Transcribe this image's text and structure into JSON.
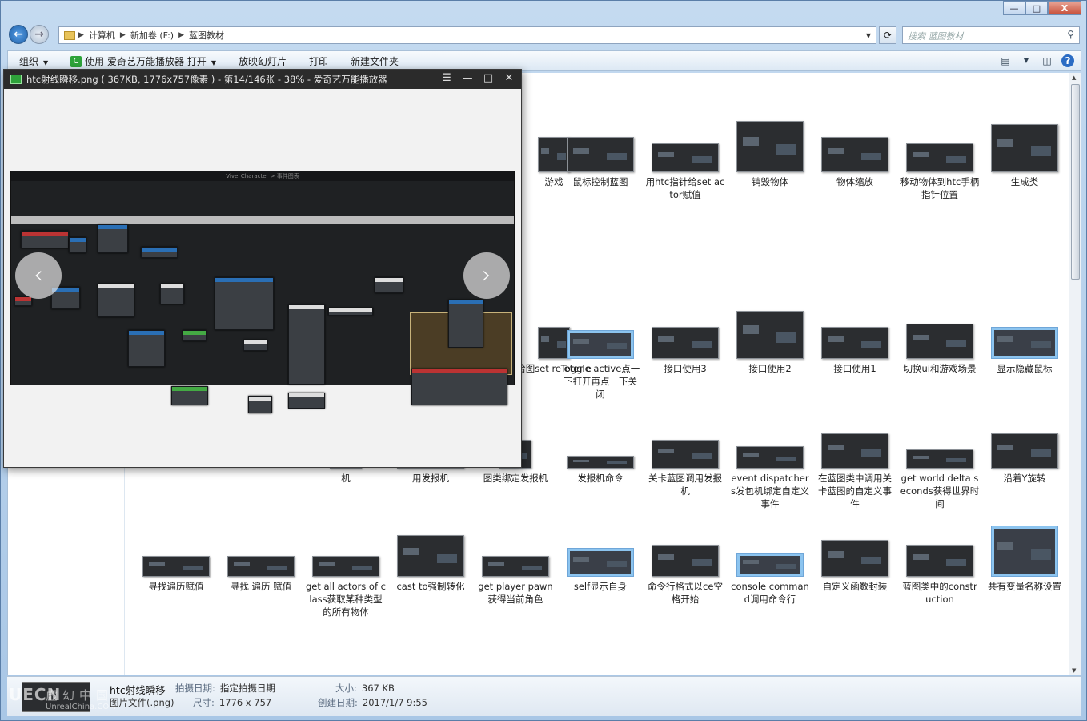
{
  "explorer": {
    "window_buttons": {
      "minimize": "—",
      "maximize": "□",
      "close": "X"
    },
    "breadcrumbs": [
      "计算机",
      "新加卷 (F:)",
      "蓝图教材"
    ],
    "search_placeholder": "搜索 蓝图教材",
    "toolbar": {
      "organize": "组织",
      "open_with": "使用 爱奇艺万能播放器 打开",
      "slideshow": "放映幻灯片",
      "print": "打印",
      "new_folder": "新建文件夹"
    },
    "items": [
      {
        "label": "游戏"
      },
      {
        "label": "鼠标控制蓝图"
      },
      {
        "label": "用htc指针给set actor赋值"
      },
      {
        "label": "销毁物体"
      },
      {
        "label": "物体缩放"
      },
      {
        "label": "移动物体到htc手柄指针位置"
      },
      {
        "label": "生成类"
      },
      {
        "label": "给图set re eter e"
      },
      {
        "label": "Toggle active点一下打开再点一下关闭"
      },
      {
        "label": "接口使用3"
      },
      {
        "label": "接口使用2"
      },
      {
        "label": "接口使用1"
      },
      {
        "label": "切换ui和游戏场景"
      },
      {
        "label": "显示隐藏鼠标"
      },
      {
        "label": "机"
      },
      {
        "label": "用发报机"
      },
      {
        "label": "图类绑定发报机"
      },
      {
        "label": "发报机命令"
      },
      {
        "label": "关卡蓝图调用发报机"
      },
      {
        "label": "event dispatchers发包机绑定自定义事件"
      },
      {
        "label": "在蓝图类中调用关卡蓝图的自定义事件"
      },
      {
        "label": "get world delta seconds获得世界时间"
      },
      {
        "label": "沿着Y旋转"
      },
      {
        "label": "寻找遍历赋值"
      },
      {
        "label": "寻找 遍历 赋值"
      },
      {
        "label": "get all actors of class获取某种类型的所有物体"
      },
      {
        "label": "cast to强制转化"
      },
      {
        "label": "get player pawn获得当前角色"
      },
      {
        "label": "self显示自身"
      },
      {
        "label": "命令行格式以ce空格开始"
      },
      {
        "label": "console command调用命令行"
      },
      {
        "label": "自定义函数封装"
      },
      {
        "label": "蓝图类中的construction"
      },
      {
        "label": "共有变量名称设置"
      }
    ],
    "status": {
      "file_name": "htc射线瞬移",
      "file_type": "图片文件(.png)",
      "date_taken_label": "拍摄日期:",
      "date_taken_value": "指定拍摄日期",
      "dimensions_label": "尺寸:",
      "dimensions_value": "1776 x 757",
      "size_label": "大小:",
      "size_value": "367 KB",
      "created_label": "创建日期:",
      "created_value": "2017/1/7 9:55",
      "watermark": "UECN",
      "watermark_cn": "虚幻中国",
      "watermark_url": "UnrealChina.COM"
    }
  },
  "viewer": {
    "title": "htc射线瞬移.png ( 367KB, 1776x757像素 ) - 第14/146张 - 38% - 爱奇艺万能播放器",
    "blueprint_header": "Vive_Character > 事件图表",
    "buttons": {
      "menu": "☰",
      "minimize": "—",
      "maximize": "□",
      "close": "✕"
    },
    "prev": "‹",
    "next": "›"
  }
}
